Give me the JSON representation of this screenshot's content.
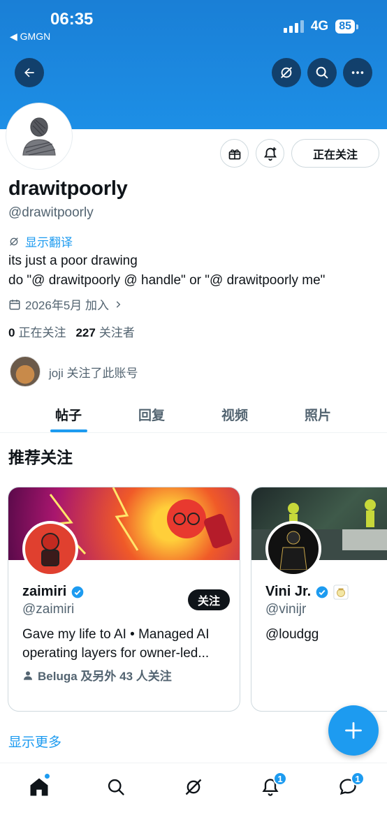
{
  "status_bar": {
    "time": "06:35",
    "back_app": "◀ GMGN",
    "network": "4G",
    "battery": "85"
  },
  "profile": {
    "display_name": "drawitpoorly",
    "handle": "@drawitpoorly",
    "translate_label": "显示翻译",
    "bio_line1": "its just a poor drawing",
    "bio_line2": "do \"@ drawitpoorly @ handle\" or \"@ drawitpoorly me\"",
    "joined": "2026年5月 加入",
    "following_count": "0",
    "following_label": "正在关注",
    "followers_count": "227",
    "followers_label": "关注者",
    "followed_by": "joji 关注了此账号",
    "follow_button": "正在关注"
  },
  "tabs": [
    {
      "label": "帖子",
      "active": true
    },
    {
      "label": "回复",
      "active": false
    },
    {
      "label": "视频",
      "active": false
    },
    {
      "label": "照片",
      "active": false
    }
  ],
  "recommended": {
    "title": "推荐关注",
    "cards": [
      {
        "name": "zaimiri",
        "handle": "@zaimiri",
        "bio": "Gave my life to AI • Managed AI operating layers for owner-led...",
        "social": "Beluga 及另外 43 人关注",
        "follow_label": "关注",
        "verified": true
      },
      {
        "name": "Vini Jr.",
        "handle": "@vinijr",
        "bio": "@loudgg",
        "verified": true
      }
    ],
    "show_more": "显示更多"
  },
  "bottom_nav": {
    "notifications_badge": "1",
    "messages_badge": "1"
  },
  "colors": {
    "accent": "#1d9bf0",
    "banner": "#1d8fe6",
    "text": "#0f1419",
    "muted": "#536471"
  }
}
